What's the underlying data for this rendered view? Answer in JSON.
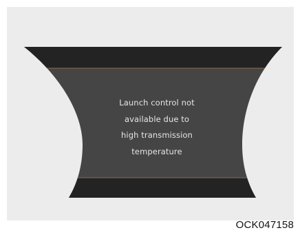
{
  "message": {
    "lines": [
      "Launch control not",
      "available due to",
      "high transmission",
      "temperature"
    ]
  },
  "figure_code": "OCK047158",
  "colors": {
    "panel_background": "#ececec",
    "display_background": "#454545",
    "display_band": "#222222",
    "divider_line": "#8b6a4c",
    "text": "#e6e6e6"
  }
}
